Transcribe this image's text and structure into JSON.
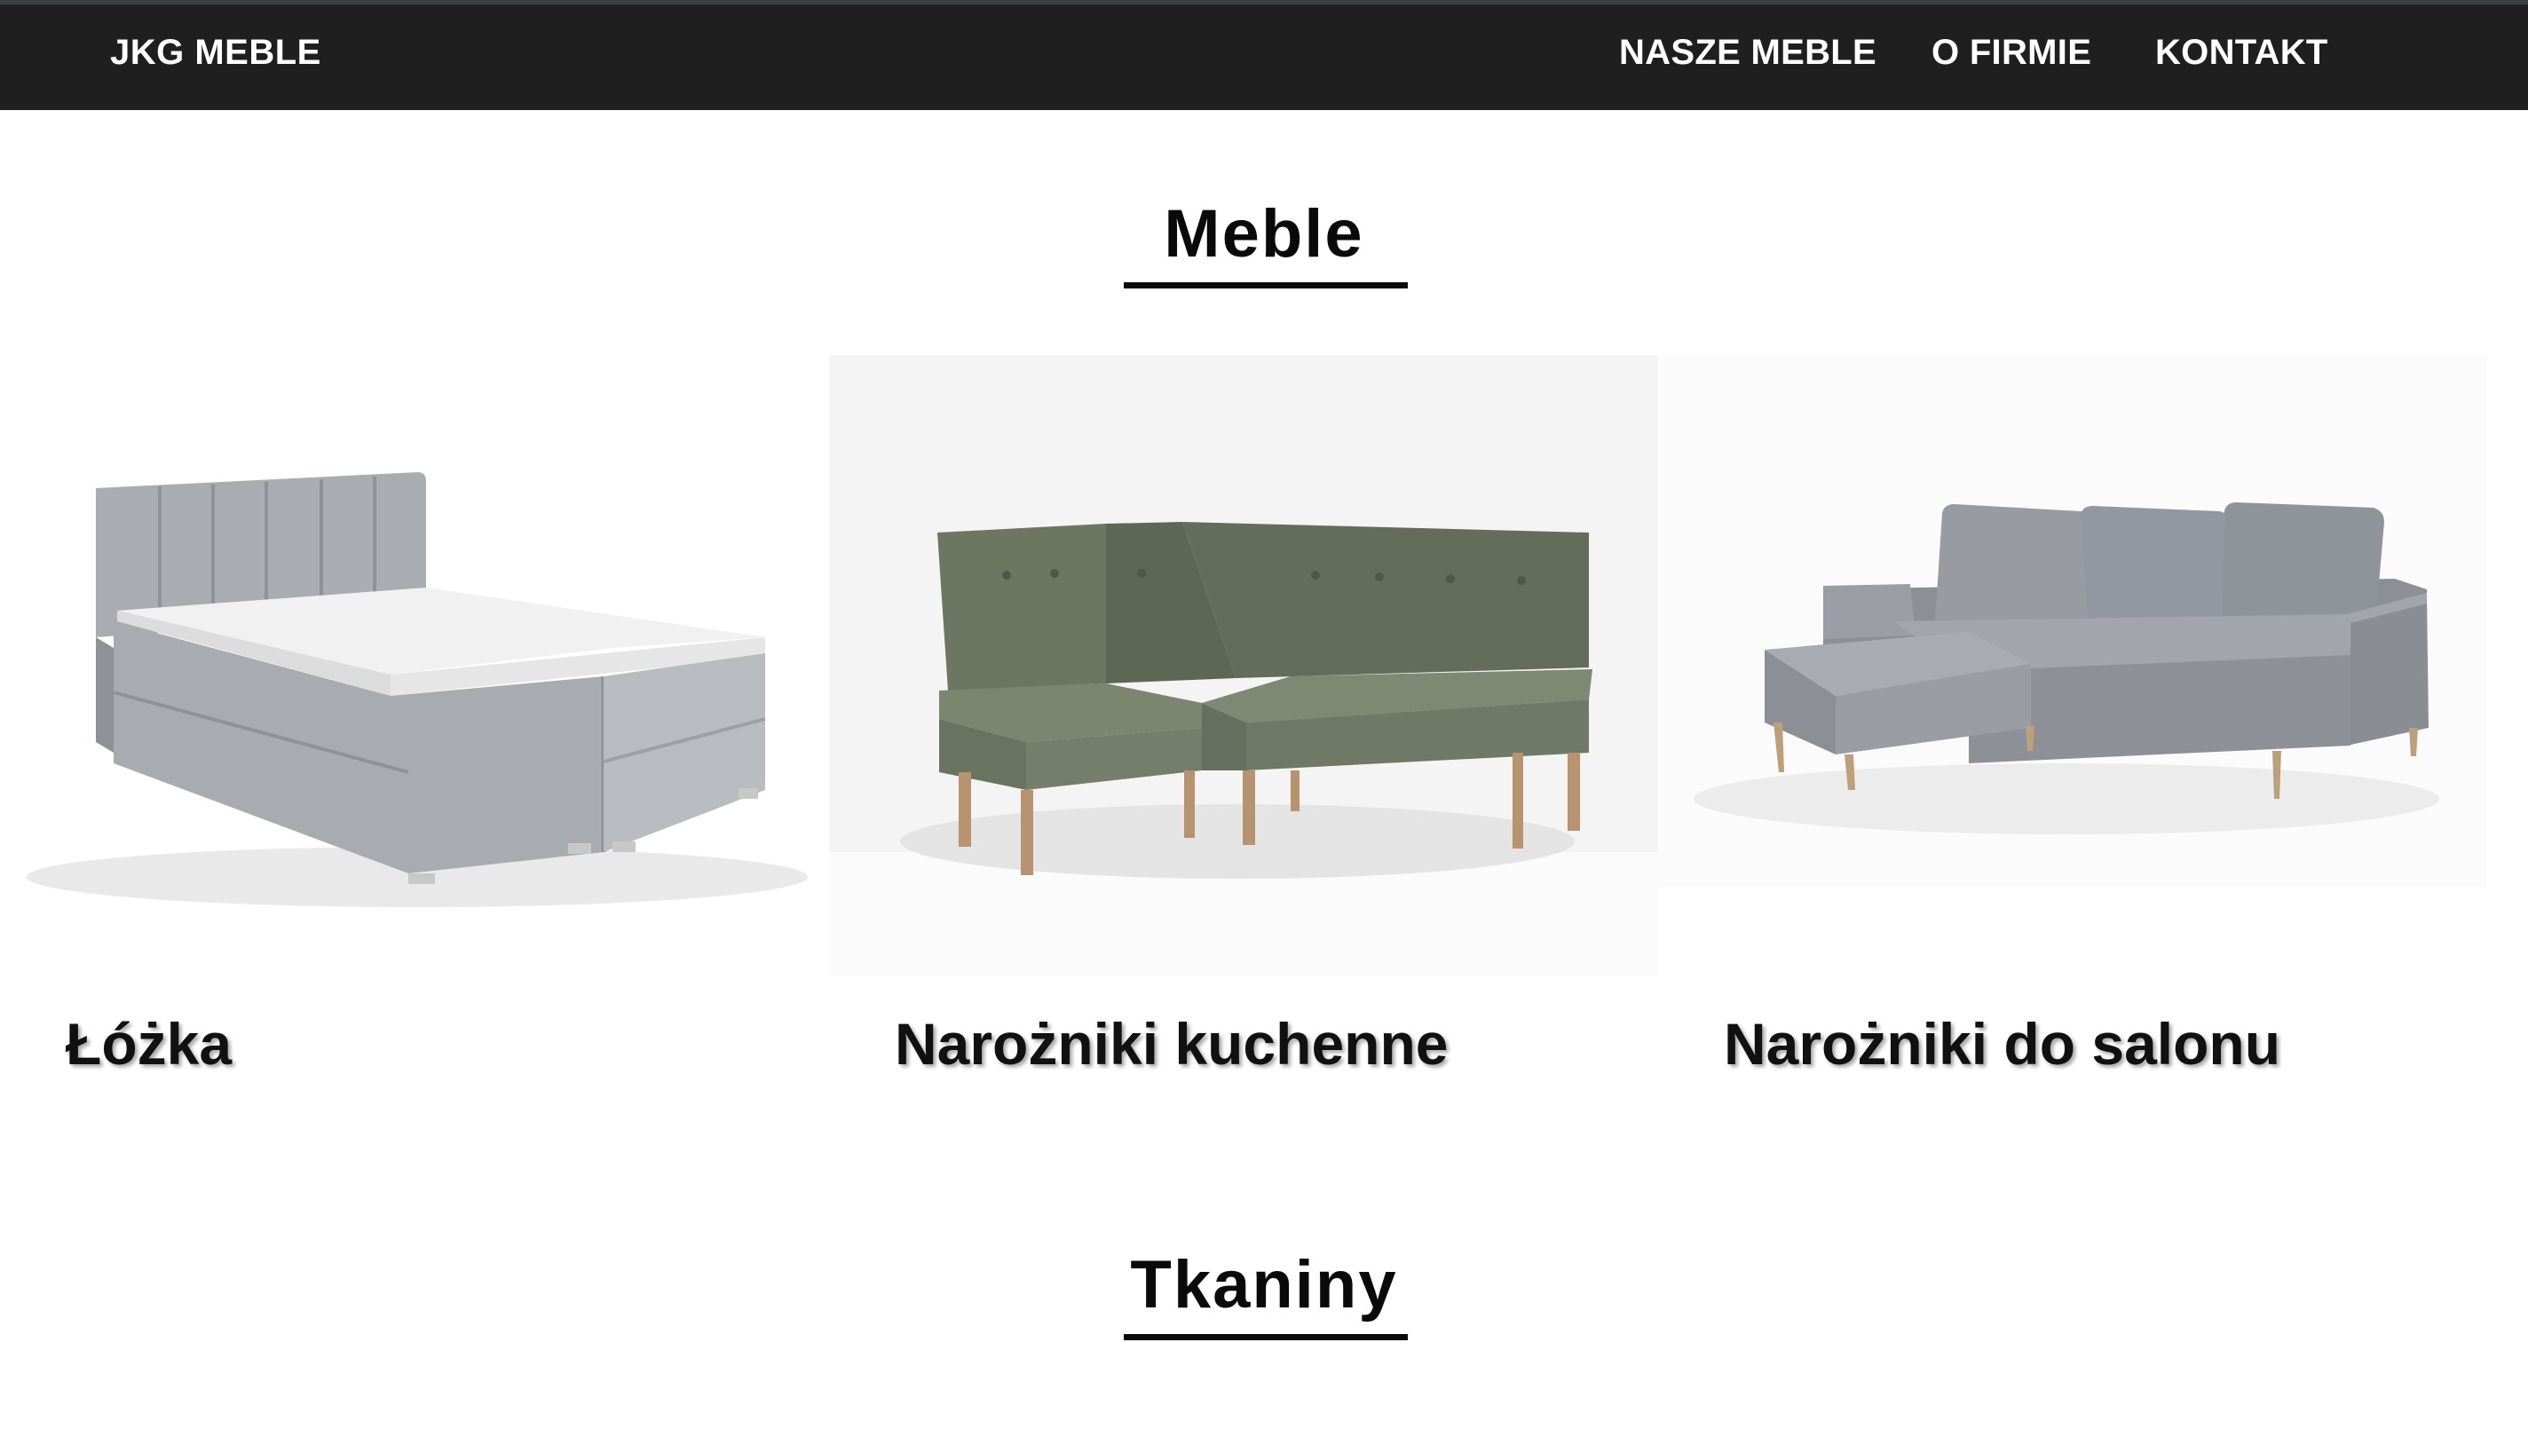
{
  "nav": {
    "brand": "JKG MEBLE",
    "items": [
      {
        "label": "NASZE MEBLE"
      },
      {
        "label": "O FIRMIE"
      },
      {
        "label": "KONTAKT"
      }
    ]
  },
  "sections": [
    {
      "title": "Meble"
    },
    {
      "title": "Tkaniny"
    }
  ],
  "products": [
    {
      "title": "Łóżka",
      "image": "bed-image"
    },
    {
      "title": "Narożniki kuchenne",
      "image": "kitchen-corner-bench-image"
    },
    {
      "title": "Narożniki do salonu",
      "image": "living-room-corner-sofa-image"
    }
  ],
  "colors": {
    "nav_background": "#1f1f1f",
    "nav_text": "#ffffff",
    "page_background": "#ffffff",
    "heading": "#0a0a0a"
  }
}
